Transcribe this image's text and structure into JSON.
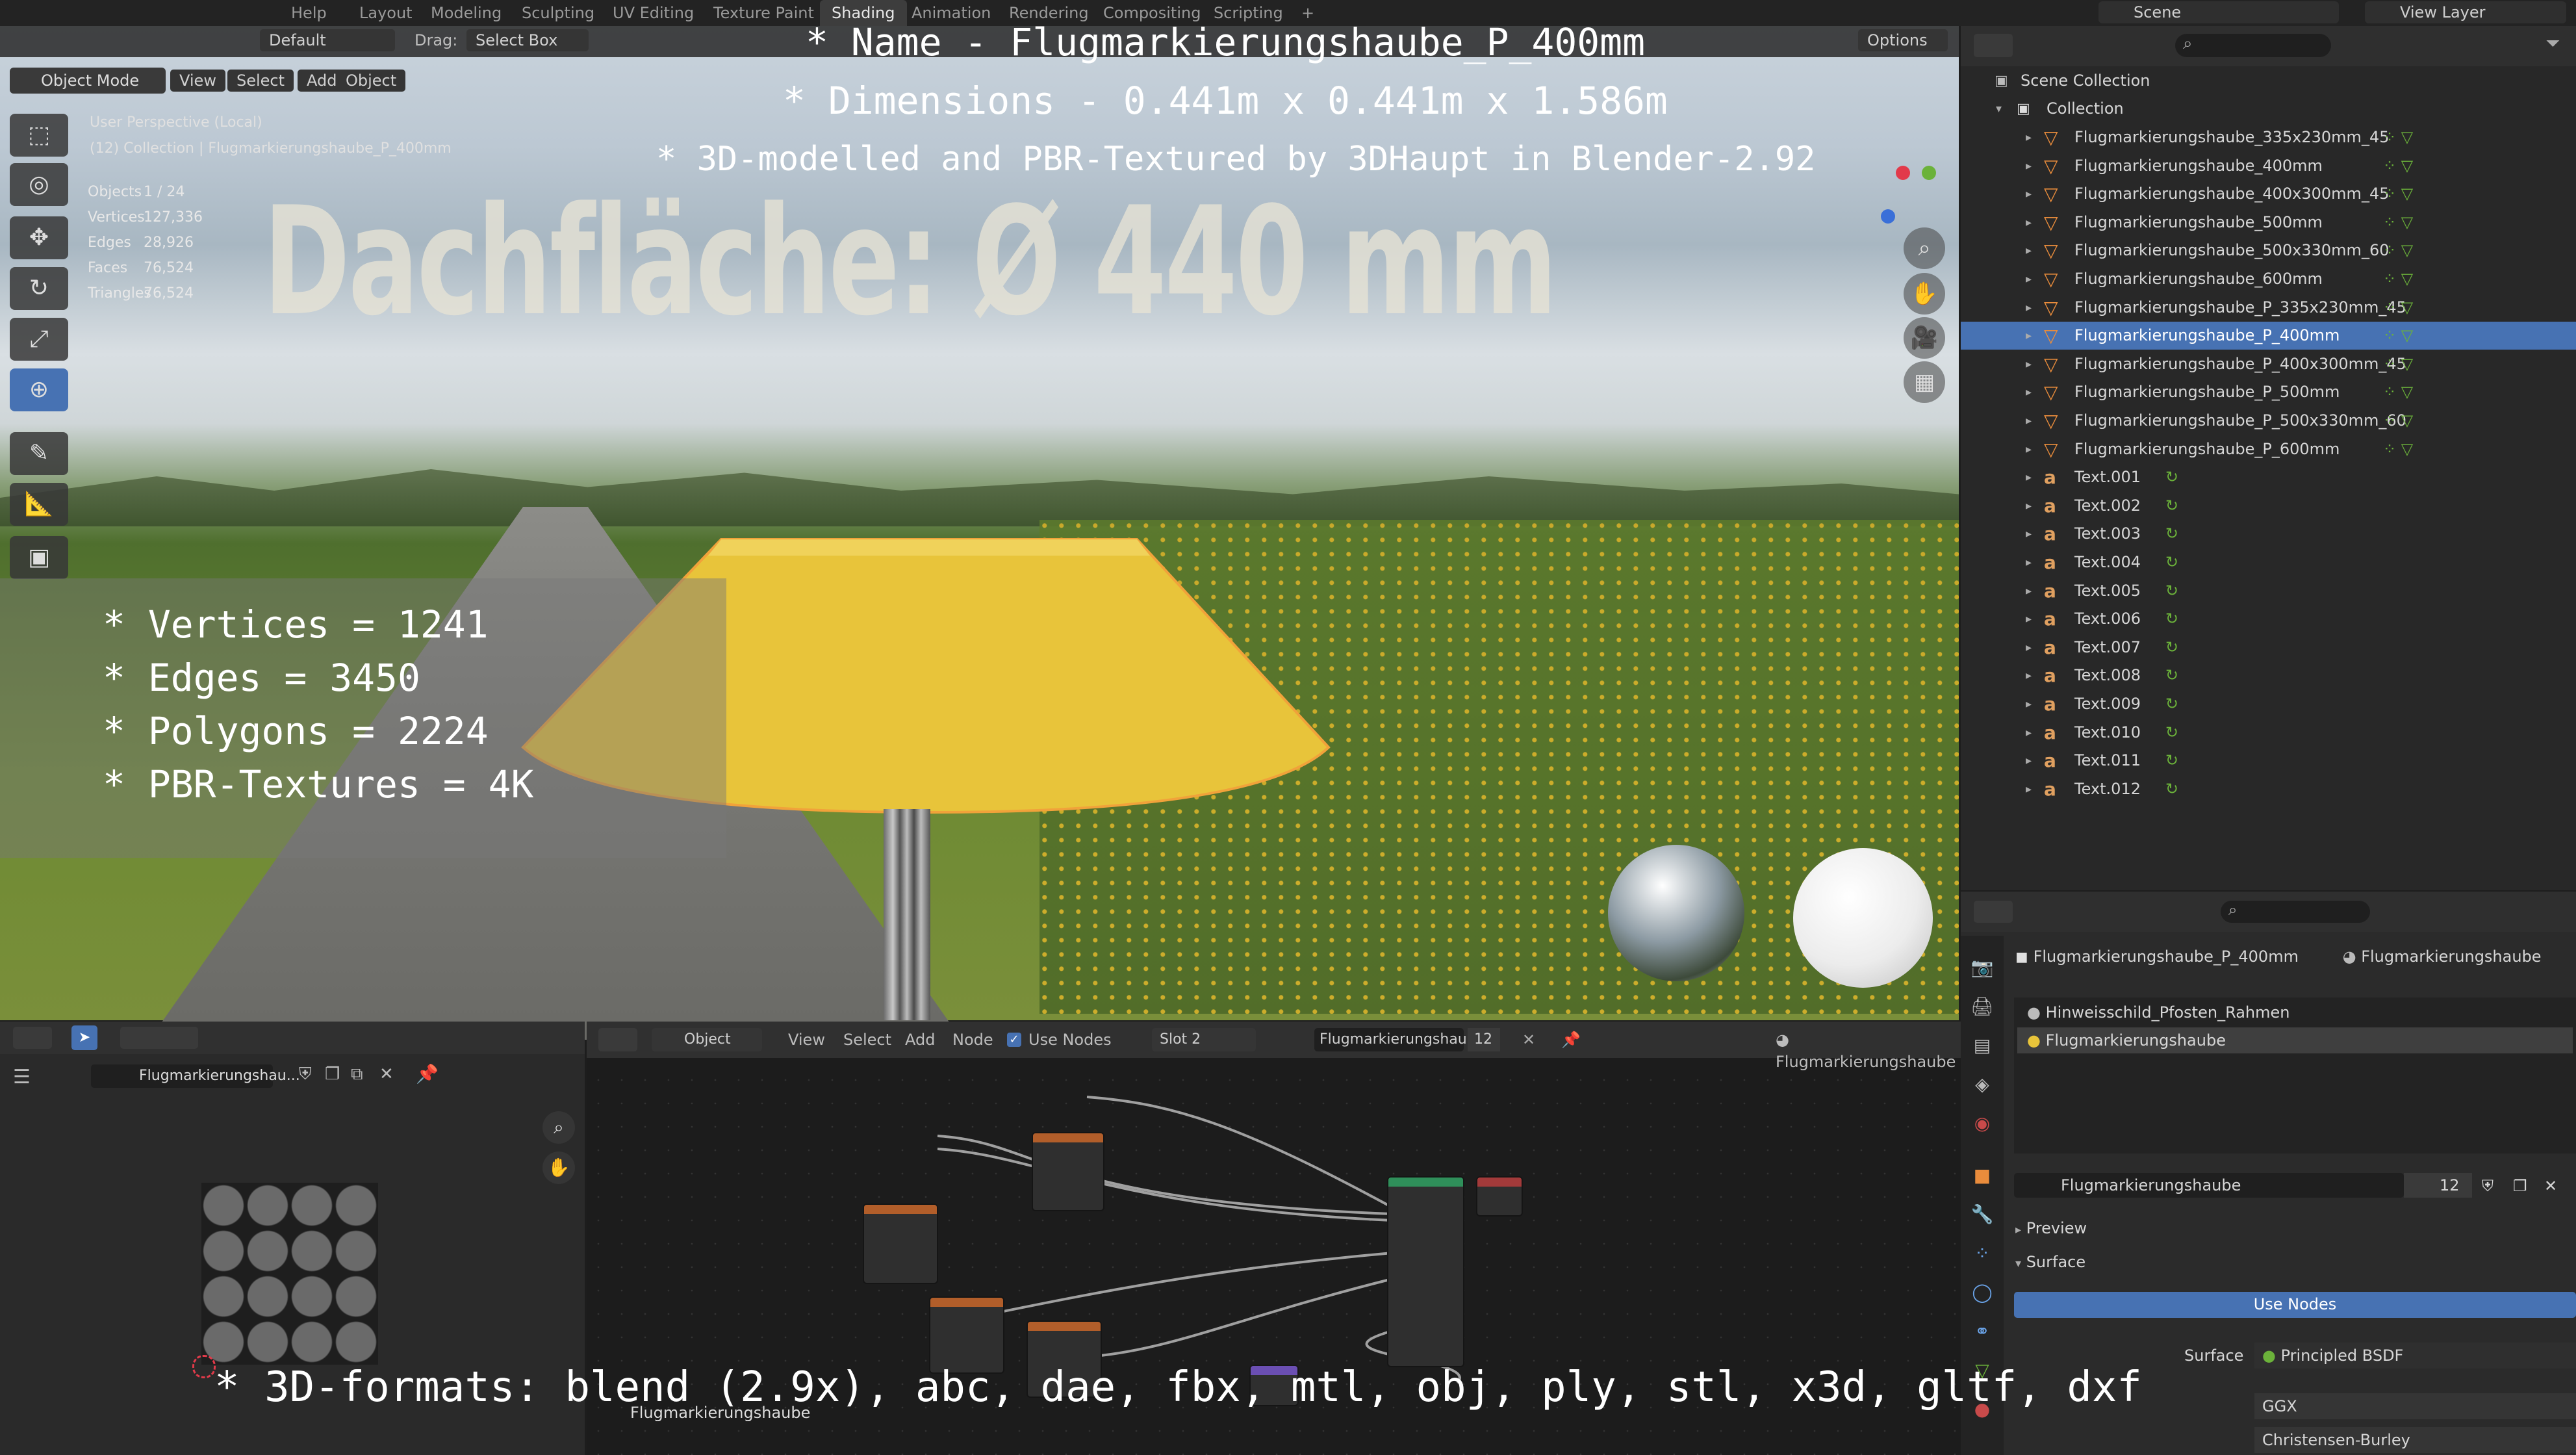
{
  "topbar": {
    "menus": [
      "Help"
    ],
    "workspaces": [
      "Layout",
      "Modeling",
      "Sculpting",
      "UV Editing",
      "Texture Paint",
      "Shading",
      "Animation",
      "Rendering",
      "Compositing",
      "Scripting"
    ],
    "active_workspace": "Shading",
    "scene": "Scene",
    "view_layer": "View Layer"
  },
  "viewport": {
    "header": {
      "orientation": "Default",
      "drag_label": "Drag:",
      "drag_value": "Select Box",
      "options": "Options",
      "mode": "Object Mode",
      "menus": [
        "View",
        "Select",
        "Add",
        "Object"
      ]
    },
    "perspective": "User Perspective (Local)",
    "collection_path": "(12) Collection | Flugmarkierungshaube_P_400mm",
    "stats": [
      {
        "k": "Objects",
        "v": "1 / 24"
      },
      {
        "k": "Vertices",
        "v": "127,336"
      },
      {
        "k": "Edges",
        "v": "28,926"
      },
      {
        "k": "Faces",
        "v": "76,524"
      },
      {
        "k": "Triangles",
        "v": "76,524"
      }
    ],
    "scene_label": "Dachfläche:  Ø 440 mm"
  },
  "overlay": {
    "title_lines": [
      "* Name - Flugmarkierungshaube_P_400mm",
      "* Dimensions -  0.441m x 0.441m x 1.586m",
      "* 3D-modelled and PBR-Textured by 3DHaupt in Blender-2.92"
    ],
    "specs": [
      "* Vertices = 1241",
      "* Edges = 3450",
      "* Polygons = 2224",
      "* PBR-Textures = 4K"
    ],
    "formats": "* 3D-formats: blend (2.9x), abc, dae, fbx, mtl, obj, ply, stl, x3d, gltf, dxf"
  },
  "outliner": {
    "scene_collection": "Scene Collection",
    "collection": "Collection",
    "items": [
      {
        "label": "Flugmarkierungshaube_335x230mm_45",
        "type": "mesh",
        "selected": false
      },
      {
        "label": "Flugmarkierungshaube_400mm",
        "type": "mesh",
        "selected": false
      },
      {
        "label": "Flugmarkierungshaube_400x300mm_45",
        "type": "mesh",
        "selected": false
      },
      {
        "label": "Flugmarkierungshaube_500mm",
        "type": "mesh",
        "selected": false
      },
      {
        "label": "Flugmarkierungshaube_500x330mm_60",
        "type": "mesh",
        "selected": false
      },
      {
        "label": "Flugmarkierungshaube_600mm",
        "type": "mesh",
        "selected": false
      },
      {
        "label": "Flugmarkierungshaube_P_335x230mm_45",
        "type": "mesh",
        "selected": false
      },
      {
        "label": "Flugmarkierungshaube_P_400mm",
        "type": "mesh",
        "selected": true
      },
      {
        "label": "Flugmarkierungshaube_P_400x300mm_45",
        "type": "mesh",
        "selected": false
      },
      {
        "label": "Flugmarkierungshaube_P_500mm",
        "type": "mesh",
        "selected": false
      },
      {
        "label": "Flugmarkierungshaube_P_500x330mm_60",
        "type": "mesh",
        "selected": false
      },
      {
        "label": "Flugmarkierungshaube_P_600mm",
        "type": "mesh",
        "selected": false
      },
      {
        "label": "Text.001",
        "type": "text",
        "selected": false
      },
      {
        "label": "Text.002",
        "type": "text",
        "selected": false
      },
      {
        "label": "Text.003",
        "type": "text",
        "selected": false
      },
      {
        "label": "Text.004",
        "type": "text",
        "selected": false
      },
      {
        "label": "Text.005",
        "type": "text",
        "selected": false
      },
      {
        "label": "Text.006",
        "type": "text",
        "selected": false
      },
      {
        "label": "Text.007",
        "type": "text",
        "selected": false
      },
      {
        "label": "Text.008",
        "type": "text",
        "selected": false
      },
      {
        "label": "Text.009",
        "type": "text",
        "selected": false
      },
      {
        "label": "Text.010",
        "type": "text",
        "selected": false
      },
      {
        "label": "Text.011",
        "type": "text",
        "selected": false
      },
      {
        "label": "Text.012",
        "type": "text",
        "selected": false
      }
    ]
  },
  "properties": {
    "object_name": "Flugmarkierungshaube_P_400mm",
    "material_name": "Flugmarkierungshaube",
    "slots": [
      "Hinweisschild_Pfosten_Rahmen",
      "Flugmarkierungshaube"
    ],
    "material_field": "Flugmarkierungshaube",
    "users": "12",
    "preview": "Preview",
    "surface_panel": "Surface",
    "use_nodes": "Use Nodes",
    "surface_label": "Surface",
    "surface_value": "Principled BSDF",
    "distribution": "GGX",
    "subsurface": "Christensen-Burley"
  },
  "image_editor": {
    "image_name": "Flugmarkierungshau..."
  },
  "node_editor": {
    "object": "Object",
    "menus": [
      "View",
      "Select",
      "Add",
      "Node"
    ],
    "use_nodes": "Use Nodes",
    "slot": "Slot 2",
    "material": "Flugmarkierungshau...",
    "users": "12",
    "breadcrumb": "Flugmarkierungshaube",
    "footer_label": "Flugmarkierungshaube"
  },
  "colors": {
    "accent": "#4772b3",
    "hood_yellow": "#e8c43a",
    "mesh_icon": "#e98c3c",
    "text_icon": "#e0a060"
  }
}
